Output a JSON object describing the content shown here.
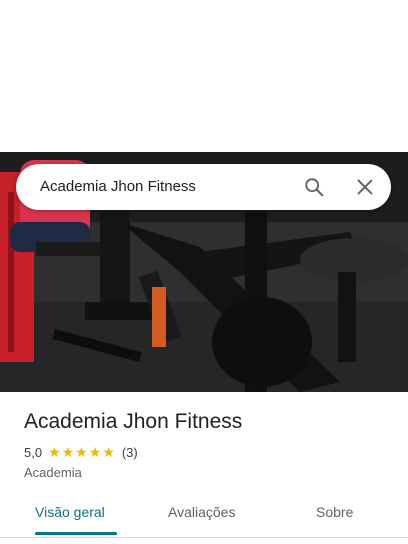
{
  "search": {
    "query": "Academia Jhon Fitness"
  },
  "place": {
    "name": "Academia Jhon Fitness",
    "rating": "5,0",
    "stars": "★★★★★",
    "reviews": "(3)",
    "category": "Academia"
  },
  "tabs": [
    {
      "label": "Visão geral",
      "active": true
    },
    {
      "label": "Avaliações"
    },
    {
      "label": "Sobre"
    }
  ],
  "colors": {
    "accent": "#0b7285",
    "star": "#f2b400"
  },
  "icons": {
    "search": "search-icon",
    "close": "close-icon"
  }
}
